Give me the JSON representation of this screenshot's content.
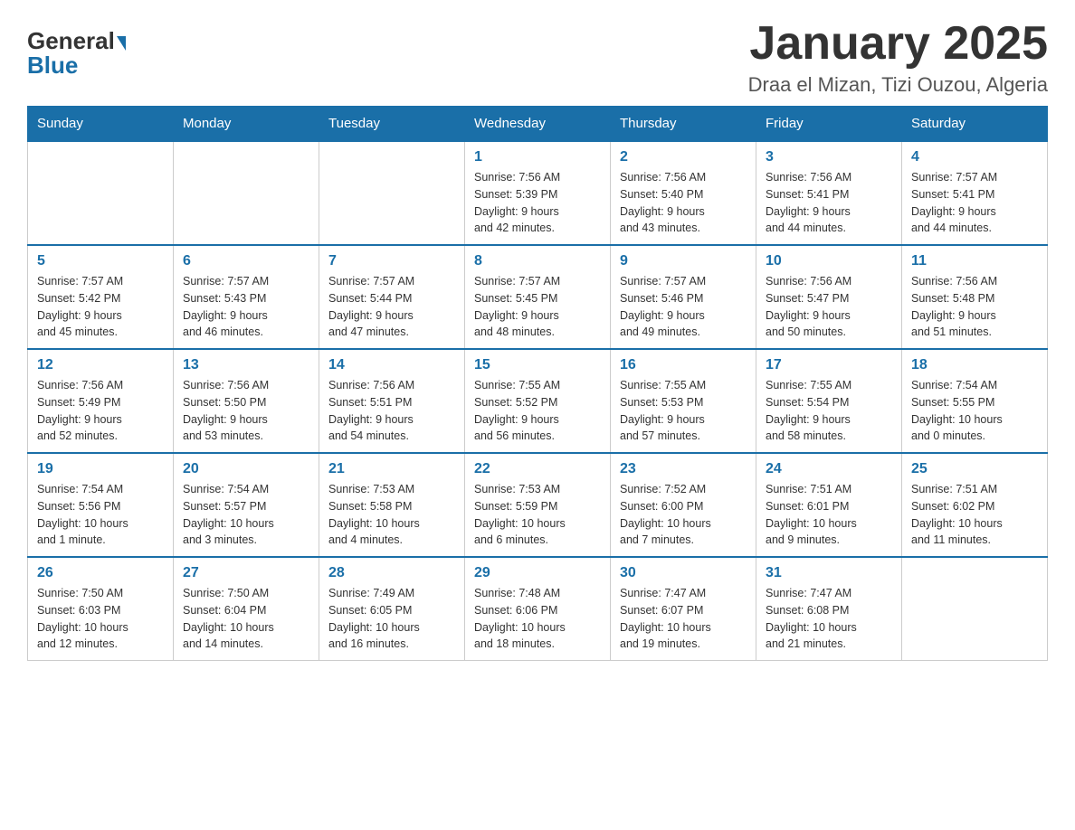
{
  "header": {
    "title": "January 2025",
    "subtitle": "Draa el Mizan, Tizi Ouzou, Algeria",
    "logo_general": "General",
    "logo_blue": "Blue"
  },
  "days_of_week": [
    "Sunday",
    "Monday",
    "Tuesday",
    "Wednesday",
    "Thursday",
    "Friday",
    "Saturday"
  ],
  "weeks": [
    [
      {
        "day": "",
        "info": ""
      },
      {
        "day": "",
        "info": ""
      },
      {
        "day": "",
        "info": ""
      },
      {
        "day": "1",
        "info": "Sunrise: 7:56 AM\nSunset: 5:39 PM\nDaylight: 9 hours\nand 42 minutes."
      },
      {
        "day": "2",
        "info": "Sunrise: 7:56 AM\nSunset: 5:40 PM\nDaylight: 9 hours\nand 43 minutes."
      },
      {
        "day": "3",
        "info": "Sunrise: 7:56 AM\nSunset: 5:41 PM\nDaylight: 9 hours\nand 44 minutes."
      },
      {
        "day": "4",
        "info": "Sunrise: 7:57 AM\nSunset: 5:41 PM\nDaylight: 9 hours\nand 44 minutes."
      }
    ],
    [
      {
        "day": "5",
        "info": "Sunrise: 7:57 AM\nSunset: 5:42 PM\nDaylight: 9 hours\nand 45 minutes."
      },
      {
        "day": "6",
        "info": "Sunrise: 7:57 AM\nSunset: 5:43 PM\nDaylight: 9 hours\nand 46 minutes."
      },
      {
        "day": "7",
        "info": "Sunrise: 7:57 AM\nSunset: 5:44 PM\nDaylight: 9 hours\nand 47 minutes."
      },
      {
        "day": "8",
        "info": "Sunrise: 7:57 AM\nSunset: 5:45 PM\nDaylight: 9 hours\nand 48 minutes."
      },
      {
        "day": "9",
        "info": "Sunrise: 7:57 AM\nSunset: 5:46 PM\nDaylight: 9 hours\nand 49 minutes."
      },
      {
        "day": "10",
        "info": "Sunrise: 7:56 AM\nSunset: 5:47 PM\nDaylight: 9 hours\nand 50 minutes."
      },
      {
        "day": "11",
        "info": "Sunrise: 7:56 AM\nSunset: 5:48 PM\nDaylight: 9 hours\nand 51 minutes."
      }
    ],
    [
      {
        "day": "12",
        "info": "Sunrise: 7:56 AM\nSunset: 5:49 PM\nDaylight: 9 hours\nand 52 minutes."
      },
      {
        "day": "13",
        "info": "Sunrise: 7:56 AM\nSunset: 5:50 PM\nDaylight: 9 hours\nand 53 minutes."
      },
      {
        "day": "14",
        "info": "Sunrise: 7:56 AM\nSunset: 5:51 PM\nDaylight: 9 hours\nand 54 minutes."
      },
      {
        "day": "15",
        "info": "Sunrise: 7:55 AM\nSunset: 5:52 PM\nDaylight: 9 hours\nand 56 minutes."
      },
      {
        "day": "16",
        "info": "Sunrise: 7:55 AM\nSunset: 5:53 PM\nDaylight: 9 hours\nand 57 minutes."
      },
      {
        "day": "17",
        "info": "Sunrise: 7:55 AM\nSunset: 5:54 PM\nDaylight: 9 hours\nand 58 minutes."
      },
      {
        "day": "18",
        "info": "Sunrise: 7:54 AM\nSunset: 5:55 PM\nDaylight: 10 hours\nand 0 minutes."
      }
    ],
    [
      {
        "day": "19",
        "info": "Sunrise: 7:54 AM\nSunset: 5:56 PM\nDaylight: 10 hours\nand 1 minute."
      },
      {
        "day": "20",
        "info": "Sunrise: 7:54 AM\nSunset: 5:57 PM\nDaylight: 10 hours\nand 3 minutes."
      },
      {
        "day": "21",
        "info": "Sunrise: 7:53 AM\nSunset: 5:58 PM\nDaylight: 10 hours\nand 4 minutes."
      },
      {
        "day": "22",
        "info": "Sunrise: 7:53 AM\nSunset: 5:59 PM\nDaylight: 10 hours\nand 6 minutes."
      },
      {
        "day": "23",
        "info": "Sunrise: 7:52 AM\nSunset: 6:00 PM\nDaylight: 10 hours\nand 7 minutes."
      },
      {
        "day": "24",
        "info": "Sunrise: 7:51 AM\nSunset: 6:01 PM\nDaylight: 10 hours\nand 9 minutes."
      },
      {
        "day": "25",
        "info": "Sunrise: 7:51 AM\nSunset: 6:02 PM\nDaylight: 10 hours\nand 11 minutes."
      }
    ],
    [
      {
        "day": "26",
        "info": "Sunrise: 7:50 AM\nSunset: 6:03 PM\nDaylight: 10 hours\nand 12 minutes."
      },
      {
        "day": "27",
        "info": "Sunrise: 7:50 AM\nSunset: 6:04 PM\nDaylight: 10 hours\nand 14 minutes."
      },
      {
        "day": "28",
        "info": "Sunrise: 7:49 AM\nSunset: 6:05 PM\nDaylight: 10 hours\nand 16 minutes."
      },
      {
        "day": "29",
        "info": "Sunrise: 7:48 AM\nSunset: 6:06 PM\nDaylight: 10 hours\nand 18 minutes."
      },
      {
        "day": "30",
        "info": "Sunrise: 7:47 AM\nSunset: 6:07 PM\nDaylight: 10 hours\nand 19 minutes."
      },
      {
        "day": "31",
        "info": "Sunrise: 7:47 AM\nSunset: 6:08 PM\nDaylight: 10 hours\nand 21 minutes."
      },
      {
        "day": "",
        "info": ""
      }
    ]
  ]
}
